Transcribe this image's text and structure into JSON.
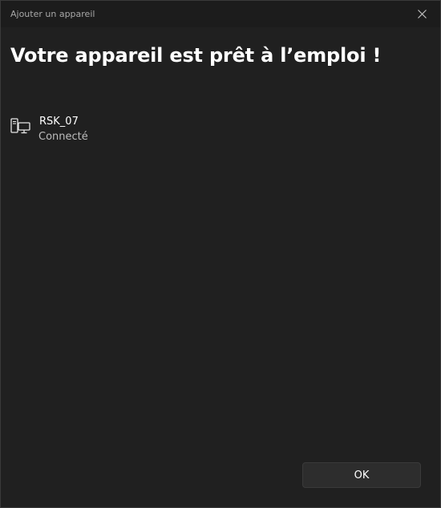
{
  "window": {
    "title": "Ajouter un appareil",
    "close_icon": "close-icon"
  },
  "main": {
    "heading": "Votre appareil est prêt à l’emploi !",
    "device": {
      "icon": "computer-monitor-icon",
      "name": "RSK_07",
      "status": "Connecté"
    }
  },
  "footer": {
    "ok_label": "OK"
  },
  "colors": {
    "background": "#202020",
    "titlebar": "#1c1c1c",
    "button": "#2d2d2d",
    "text": "#ffffff",
    "secondary_text": "#bdbdbd"
  }
}
